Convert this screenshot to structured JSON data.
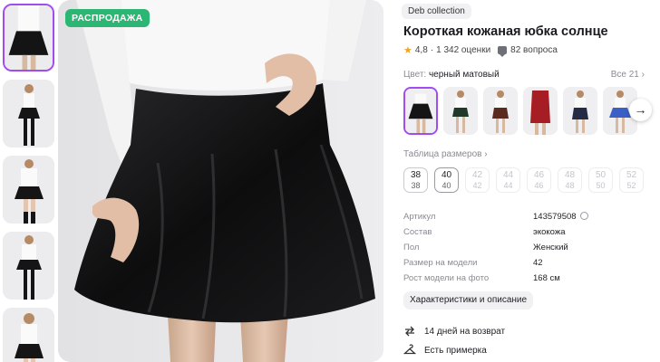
{
  "gallery": {
    "badge": "РАСПРОДАЖА",
    "thumbnails": [
      "thumb-1",
      "thumb-2",
      "thumb-3",
      "thumb-4",
      "thumb-5"
    ]
  },
  "product": {
    "brand": "Deb collection",
    "title": "Короткая кожаная юбка солнце",
    "rating": "4,8",
    "separator": "·",
    "reviews": "1 342 оценки",
    "questions": "82 вопроса"
  },
  "color": {
    "label": "Цвет:",
    "value": "черный матовый",
    "all_link": "Все 21",
    "swatch_colors": [
      "#151515",
      "#1f3a2a",
      "#5a2a1e",
      "#a61d23",
      "#262b45",
      "#3b5fc4"
    ]
  },
  "sizes": {
    "table_link": "Таблица размеров",
    "items": [
      {
        "ru": "38",
        "intl": "38",
        "available": true
      },
      {
        "ru": "40",
        "intl": "40",
        "available": true
      },
      {
        "ru": "42",
        "intl": "42",
        "available": false
      },
      {
        "ru": "44",
        "intl": "44",
        "available": false
      },
      {
        "ru": "46",
        "intl": "46",
        "available": false
      },
      {
        "ru": "48",
        "intl": "48",
        "available": false
      },
      {
        "ru": "50",
        "intl": "50",
        "available": false
      },
      {
        "ru": "52",
        "intl": "52",
        "available": false
      }
    ]
  },
  "specs": [
    {
      "label": "Артикул",
      "value": "143579508"
    },
    {
      "label": "Состав",
      "value": "экокожа"
    },
    {
      "label": "Пол",
      "value": "Женский"
    },
    {
      "label": "Размер на модели",
      "value": "42"
    },
    {
      "label": "Рост модели на фото",
      "value": "168 см"
    }
  ],
  "characteristics_button": "Характеристики и описание",
  "perks": [
    {
      "icon": "return-arrows-icon",
      "text": "14 дней на возврат"
    },
    {
      "icon": "hanger-icon",
      "text": "Есть примерка"
    }
  ]
}
